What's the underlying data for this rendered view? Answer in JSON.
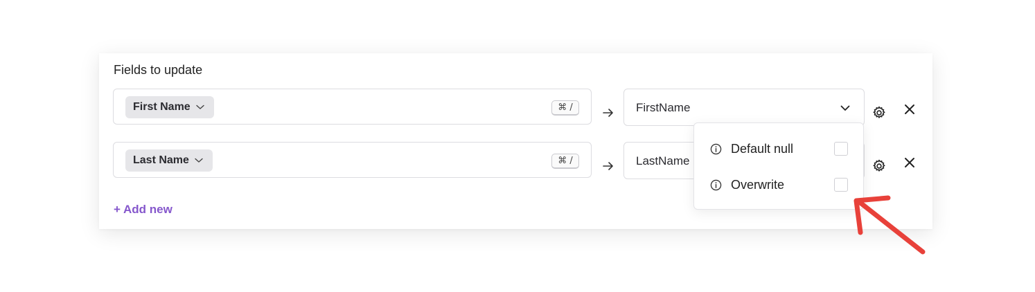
{
  "section": {
    "title": "Fields to update"
  },
  "rows": [
    {
      "source": {
        "label": "First Name",
        "shortcut": "⌘ /"
      },
      "destination": {
        "value": "FirstName"
      }
    },
    {
      "source": {
        "label": "Last Name",
        "shortcut": "⌘ /"
      },
      "destination": {
        "value": "LastName"
      }
    }
  ],
  "add_new": {
    "label": "+ Add new"
  },
  "popover": {
    "options": [
      {
        "label": "Default null",
        "checked": false
      },
      {
        "label": "Overwrite",
        "checked": false
      }
    ]
  },
  "icons": {
    "chip_caret": "chevron-down-icon",
    "dropdown_caret": "chevron-down-icon",
    "mapping": "arrow-right-icon",
    "settings": "gear-icon",
    "remove": "close-icon",
    "option_info": "info-icon"
  },
  "colors": {
    "accent": "#8557cc",
    "annotation": "#e8413a"
  }
}
